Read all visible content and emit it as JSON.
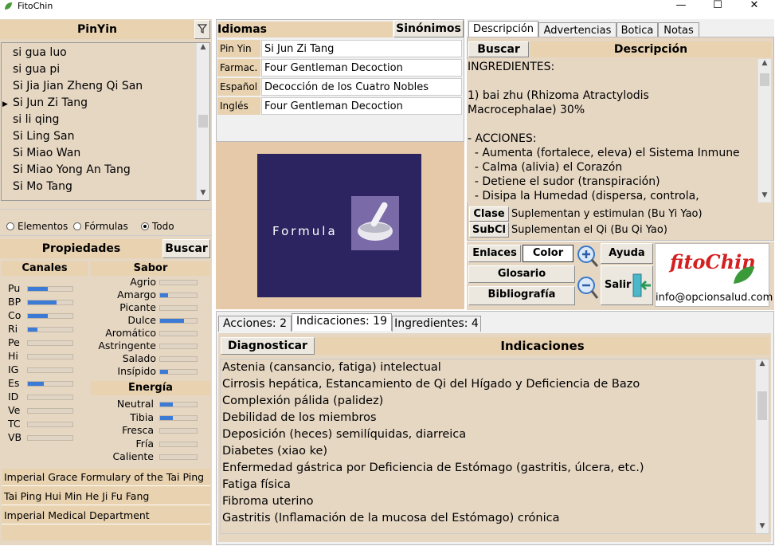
{
  "window": {
    "title": "FitoChin",
    "minimize": "—",
    "maximize": "☐",
    "close": "✕"
  },
  "left": {
    "list_header": "PinYin",
    "list_items": [
      "si gua luo",
      "si gua pi",
      "Si Jia Jian Zheng Qi San",
      "Si Jun Zi Tang",
      "si li qing",
      "Si Ling San",
      "Si Miao Wan",
      "Si Miao Yong An Tang",
      "Si Mo Tang"
    ],
    "selected_index": 3,
    "filter": {
      "options": [
        "Elementos",
        "Fórmulas",
        "Todo"
      ],
      "selected": "Todo"
    },
    "properties_header": "Propiedades",
    "properties_button": "Buscar",
    "canales": {
      "header": "Canales",
      "items": [
        {
          "label": "Pu",
          "value": 0.45
        },
        {
          "label": "BP",
          "value": 0.65
        },
        {
          "label": "Co",
          "value": 0.45
        },
        {
          "label": "Ri",
          "value": 0.22
        },
        {
          "label": "Pe",
          "value": 0
        },
        {
          "label": "Hi",
          "value": 0
        },
        {
          "label": "IG",
          "value": 0
        },
        {
          "label": "Es",
          "value": 0.35
        },
        {
          "label": "ID",
          "value": 0
        },
        {
          "label": "Ve",
          "value": 0
        },
        {
          "label": "TC",
          "value": 0
        },
        {
          "label": "VB",
          "value": 0
        }
      ]
    },
    "sabor": {
      "header": "Sabor",
      "items": [
        {
          "label": "Agrio",
          "value": 0
        },
        {
          "label": "Amargo",
          "value": 0.22
        },
        {
          "label": "Picante",
          "value": 0
        },
        {
          "label": "Dulce",
          "value": 0.65
        },
        {
          "label": "Aromático",
          "value": 0
        },
        {
          "label": "Astringente",
          "value": 0
        },
        {
          "label": "Salado",
          "value": 0
        },
        {
          "label": "Insípido",
          "value": 0.22
        }
      ]
    },
    "energia": {
      "header": "Energía",
      "items": [
        {
          "label": "Neutral",
          "value": 0.35
        },
        {
          "label": "Tibia",
          "value": 0.35
        },
        {
          "label": "Fresca",
          "value": 0
        },
        {
          "label": "Fría",
          "value": 0
        },
        {
          "label": "Caliente",
          "value": 0
        }
      ]
    },
    "sources": [
      "Imperial Grace Formulary of the Tai Ping",
      "Tai Ping Hui Min He Ji Fu Fang",
      "Imperial Medical Department"
    ]
  },
  "middle": {
    "header": "Idiomas",
    "synonyms_button": "Sinónimos",
    "languages": [
      {
        "label": "Pin Yin",
        "value": "Si Jun Zi Tang"
      },
      {
        "label": "Farmac.",
        "value": "Four Gentleman Decoction"
      },
      {
        "label": "Español",
        "value": "Decocción de los Cuatro Nobles"
      },
      {
        "label": "Inglés",
        "value": "Four Gentleman Decoction"
      }
    ],
    "image_caption": "Formula"
  },
  "right": {
    "tabs": [
      "Descripción",
      "Advertencias",
      "Botica",
      "Notas"
    ],
    "active_tab": "Descripción",
    "search_button": "Buscar",
    "desc_header": "Descripción",
    "description_lines": [
      "INGREDIENTES:",
      "",
      "1) bai zhu (Rhizoma Atractylodis",
      "Macrocephalae) 30%",
      "",
      "- ACCIONES:",
      "  - Aumenta (fortalece, eleva) el Sistema Inmune",
      "  - Calma (alivia) el Corazón",
      "  - Detiene el sudor (transpiración)",
      "  - Disipa la Humedad (dispersa, controla,"
    ],
    "clase": {
      "label": "Clase",
      "value": "Suplementan y estimulan (Bu Yi Yao)"
    },
    "subcl": {
      "label": "SubCl",
      "value": "Suplementan el Qi (Bu Qi Yao)"
    },
    "buttons": {
      "enlaces": "Enlaces",
      "color": "Color",
      "ayuda": "Ayuda",
      "glosario": "Glosario",
      "bibliografia": "Bibliografía",
      "salir": "Salir"
    },
    "logo_text": "fitoChin",
    "email": "info@opcionsalud.com"
  },
  "bottom": {
    "tabs": [
      "Acciones: 2",
      "Indicaciones: 19",
      "Ingredientes: 4"
    ],
    "active_tab": "Indicaciones: 19",
    "diagnose_button": "Diagnosticar",
    "header": "Indicaciones",
    "indications": [
      "Astenia (cansancio, fatiga) intelectual",
      "Cirrosis hepática, Estancamiento de Qi del Hígado y Deficiencia de Bazo",
      "Complexión pálida (palidez)",
      "Debilidad de los miembros",
      "Deposición (heces) semilíquidas, diarreica",
      "Diabetes (xiao ke)",
      "Enfermedad gástrica por Deficiencia de Estómago (gastritis, úlcera, etc.)",
      "Fatiga física",
      "Fibroma uterino",
      "Gastritis (Inflamación de la mucosa del Estómago) crónica"
    ]
  },
  "colors": {
    "panel": "#e6d7c3",
    "header": "#e8d2b0",
    "bar_fill": "#3b7bd6",
    "image_bg": "#2c2460"
  }
}
